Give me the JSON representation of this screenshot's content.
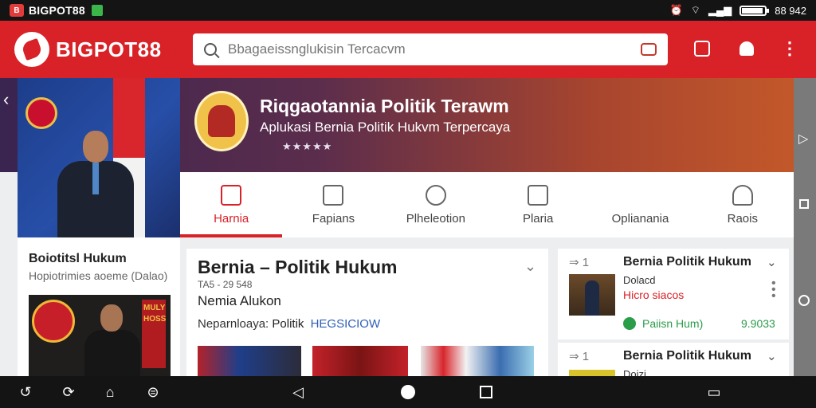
{
  "status_bar": {
    "app_name": "BIGPOT88",
    "time": "88 942",
    "battery_level": 0.85
  },
  "app_bar": {
    "logo_text": "BIGPOT88",
    "search_placeholder": "Bbagaeissnglukisin Tercacvm"
  },
  "banner": {
    "title": "Riqgaotannia Politik Terawm",
    "subtitle": "Aplukasi Bernia Politik Hukvm Terpercaya",
    "stars": "★★★★★"
  },
  "tabs": [
    {
      "label": "Harnia",
      "icon": "home-icon",
      "active": true
    },
    {
      "label": "Fapians",
      "icon": "send-icon",
      "active": false
    },
    {
      "label": "Plheleotion",
      "icon": "help-icon",
      "active": false
    },
    {
      "label": "Plaria",
      "icon": "house-icon",
      "active": false
    },
    {
      "label": "Oplianania",
      "icon": "",
      "active": false
    },
    {
      "label": "Raois",
      "icon": "alert-icon",
      "active": false
    }
  ],
  "left_panel": {
    "title": "Boiotitsl Hukum",
    "subtitle": "Hopiotrimies aoeme (Dalao)",
    "thumb_text": "MULY HOSS"
  },
  "main_card": {
    "title": "Bernia – Politik Hukum",
    "meta": "TA5 - 29 548",
    "subtitle": "Nemia Alukon",
    "category_label": "Neparnloaya:",
    "category_value": "Politik",
    "category_link": "HEGSICIOW"
  },
  "side_cards": [
    {
      "rank": "1",
      "title": "Bernia Politik Hukum",
      "line1": "Dolacd",
      "line2": "Hicro siacos",
      "play_label": "Paiisn Hum)",
      "price": "9.9033"
    },
    {
      "rank": "1",
      "title": "Bernia Politik Hukum",
      "line1": "Doizi"
    }
  ],
  "colors": {
    "brand_red": "#d92128",
    "accent_green": "#2a9d49",
    "link_blue": "#2d5fb8"
  }
}
